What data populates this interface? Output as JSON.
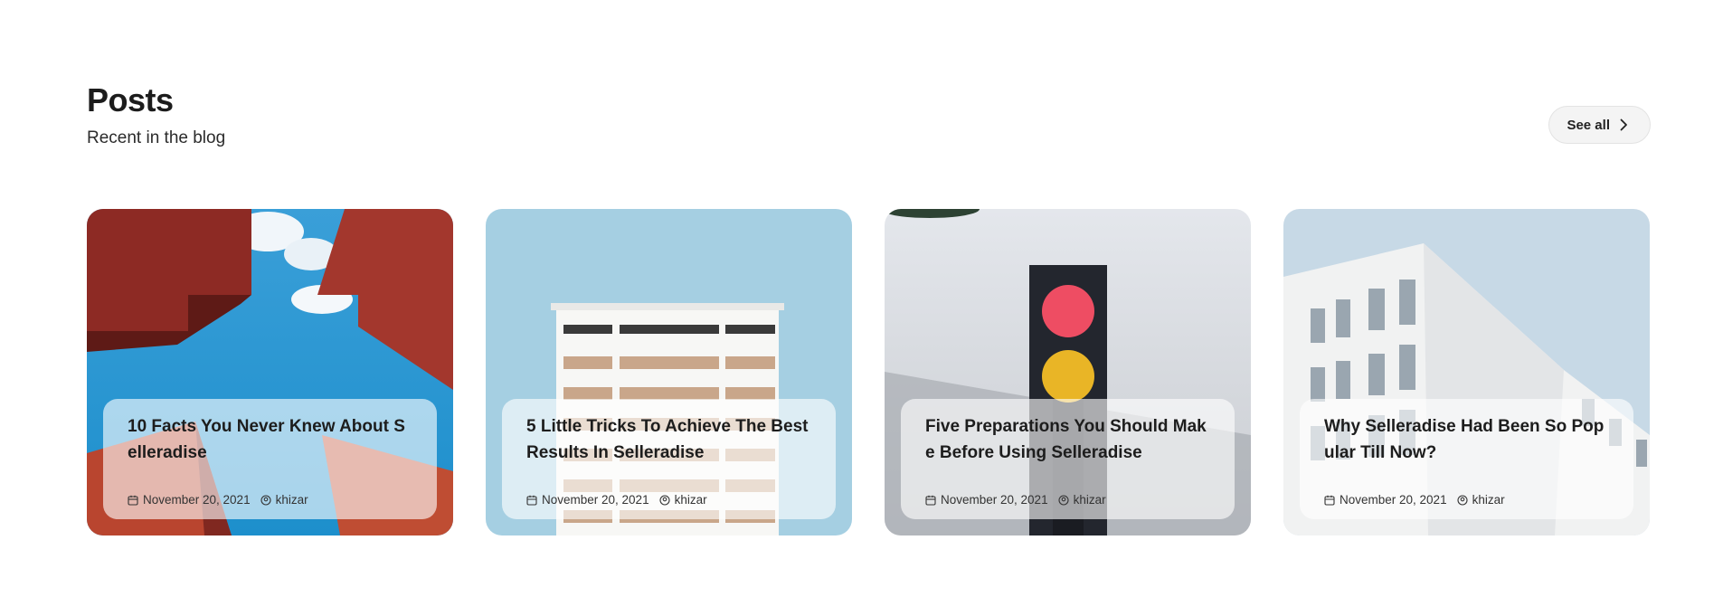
{
  "section": {
    "title": "Posts",
    "subtitle": "Recent in the blog",
    "see_all_label": "See all"
  },
  "posts": [
    {
      "title": "10 Facts You Never Knew About Selleradise",
      "date": "November 20, 2021",
      "author": "khizar",
      "image": "red-sculpture-blue-sky"
    },
    {
      "title": "5 Little Tricks To Achieve The Best Results In Selleradise",
      "date": "November 20, 2021",
      "author": "khizar",
      "image": "white-building-blue-sky"
    },
    {
      "title": "Five Preparations You Should Make Before Using Selleradise",
      "date": "November 20, 2021",
      "author": "khizar",
      "image": "traffic-light"
    },
    {
      "title": "Why Selleradise Had Been So Popular Till Now?",
      "date": "November 20, 2021",
      "author": "khizar",
      "image": "modern-white-building"
    }
  ],
  "icons": {
    "date": "calendar-icon",
    "author": "user-circle-icon",
    "see_all": "chevron-right-icon"
  }
}
